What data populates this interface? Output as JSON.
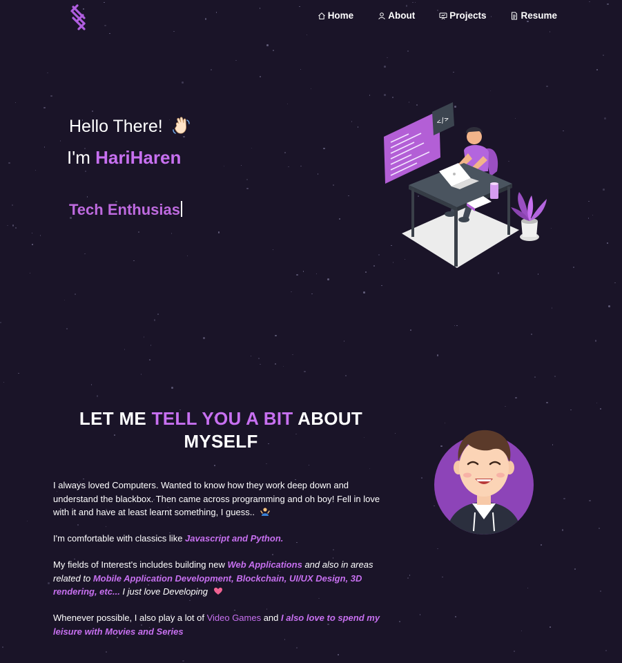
{
  "nav": {
    "items": [
      {
        "label": "Home",
        "icon": "home-icon"
      },
      {
        "label": "About",
        "icon": "user-icon"
      },
      {
        "label": "Projects",
        "icon": "projects-icon"
      },
      {
        "label": "Resume",
        "icon": "document-icon"
      }
    ]
  },
  "hero": {
    "greeting": "Hello There!",
    "name_prefix": "I'm ",
    "name": "HariHaren",
    "typewriter": "Tech Enthusias"
  },
  "about": {
    "title_pre": "LET ME ",
    "title_accent": "TELL YOU A BIT",
    "title_post": " ABOUT MYSELF",
    "p1": "I always loved Computers. Wanted to know how they work deep down and understand the blackbox. Then came across programming and oh boy! Fell in love with it and have at least learnt something, I guess..",
    "p2_pre": "I'm comfortable with classics like ",
    "p2_accent": "Javascript and Python.",
    "p3_pre": "My fields of Interest's includes building new ",
    "p3_accent1": "Web Applications",
    "p3_mid": " and also in areas related to ",
    "p3_accent2": "Mobile Application Development, Blockchain, UI/UX Design, 3D rendering, etc...",
    "p3_post": " I just love Developing",
    "p4_pre": "Whenever possible, I also play a lot of ",
    "p4_accent1": "Video Games",
    "p4_mid": " and ",
    "p4_accent2": "I also love to spend my leisure with Movies and Series"
  },
  "colors": {
    "background": "#1a1428",
    "accent": "#c770f0"
  }
}
